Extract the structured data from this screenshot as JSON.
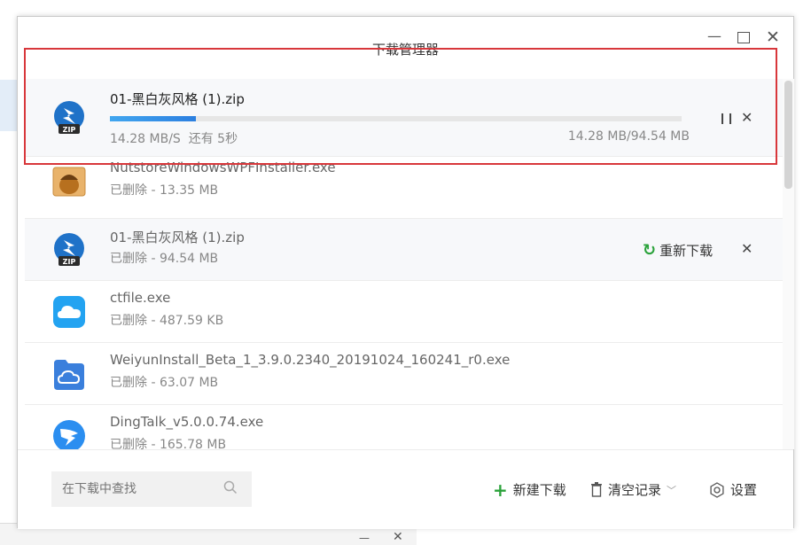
{
  "window": {
    "title": "下载管理器"
  },
  "active_download": {
    "filename": "01-黑白灰风格 (1).zip",
    "progress_percent": 15,
    "speed": "14.28 MB/S",
    "remaining": "还有 5秒",
    "size": "14.28 MB/94.54 MB",
    "icon": "zip-icon"
  },
  "history": [
    {
      "filename": "NutstoreWindowsWPFInstaller.exe",
      "status": "已删除 - 13.35 MB",
      "icon": "nutstore-icon"
    },
    {
      "filename": "01-黑白灰风格 (1).zip",
      "status": "已删除 - 94.54 MB",
      "icon": "zip-icon",
      "action": "重新下载"
    },
    {
      "filename": "ctfile.exe",
      "status": "已删除 - 487.59 KB",
      "icon": "cloud-icon"
    },
    {
      "filename": "WeiyunInstall_Beta_1_3.9.0.2340_20191024_160241_r0.exe",
      "status": "已删除 - 63.07 MB",
      "icon": "weiyun-icon"
    },
    {
      "filename": "DingTalk_v5.0.0.74.exe",
      "status": "已删除 - 165.78 MB",
      "icon": "dingtalk-icon"
    }
  ],
  "footer": {
    "search_placeholder": "在下载中查找",
    "new_download": "新建下载",
    "clear_history": "清空记录",
    "settings": "设置"
  },
  "colors": {
    "accent_green": "#2aa23a",
    "progress_blue": "#2c7fe0",
    "highlight_red": "#d8373b"
  }
}
